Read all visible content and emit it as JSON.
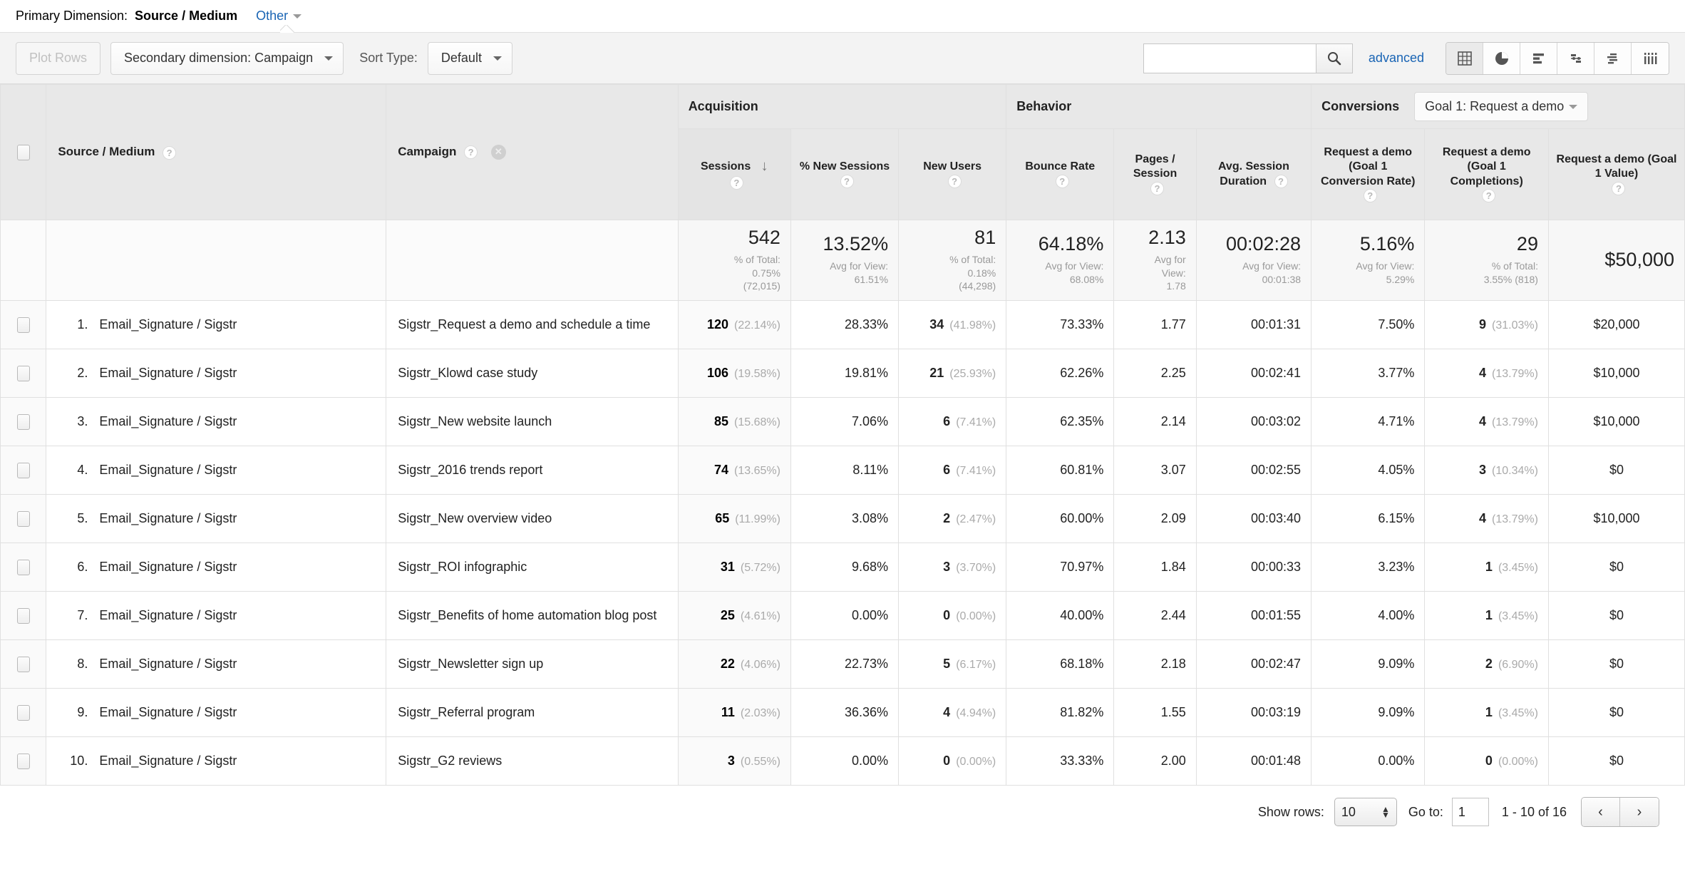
{
  "primary_dimension": {
    "label": "Primary Dimension:",
    "value": "Source / Medium",
    "other": "Other"
  },
  "toolbar": {
    "plot_rows": "Plot Rows",
    "secondary_dimension": "Secondary dimension: Campaign",
    "sort_type_label": "Sort Type:",
    "sort_type_value": "Default",
    "search_value": "",
    "search_placeholder": "",
    "advanced": "advanced",
    "view_icons": [
      "table-view-icon",
      "pie-chart-view-icon",
      "performance-view-icon",
      "comparison-view-icon",
      "term-cloud-view-icon",
      "pivot-view-icon"
    ]
  },
  "table": {
    "groups": {
      "acquisition": "Acquisition",
      "behavior": "Behavior",
      "conversions": "Conversions",
      "goal_select": "Goal 1: Request a demo"
    },
    "dimension_headers": [
      "Source / Medium",
      "Campaign"
    ],
    "metric_headers": [
      "Sessions",
      "% New Sessions",
      "New Users",
      "Bounce Rate",
      "Pages / Session",
      "Avg. Session Duration",
      "Request a demo (Goal 1 Conversion Rate)",
      "Request a demo (Goal 1 Completions)",
      "Request a demo (Goal 1 Value)"
    ],
    "summary": [
      {
        "value": "542",
        "sub1": "% of Total:",
        "sub2": "0.75%",
        "sub3": "(72,015)"
      },
      {
        "value": "13.52%",
        "sub1": "Avg for View:",
        "sub2": "61.51%",
        "sub3": ""
      },
      {
        "value": "81",
        "sub1": "% of Total:",
        "sub2": "0.18%",
        "sub3": "(44,298)"
      },
      {
        "value": "64.18%",
        "sub1": "Avg for View:",
        "sub2": "68.08%",
        "sub3": ""
      },
      {
        "value": "2.13",
        "sub1": "Avg for",
        "sub2": "View:",
        "sub3": "1.78"
      },
      {
        "value": "00:02:28",
        "sub1": "Avg for View:",
        "sub2": "00:01:38",
        "sub3": ""
      },
      {
        "value": "5.16%",
        "sub1": "Avg for View:",
        "sub2": "5.29%",
        "sub3": ""
      },
      {
        "value": "29",
        "sub1": "% of Total:",
        "sub2": "3.55% (818)",
        "sub3": ""
      },
      {
        "value": "$50,000",
        "sub1": "",
        "sub2": "",
        "sub3": ""
      }
    ],
    "rows": [
      {
        "n": "1.",
        "source": "Email_Signature / Sigstr",
        "campaign": "Sigstr_Request a demo and schedule a time",
        "sessions": "120",
        "sessions_pct": "(22.14%)",
        "new_sessions": "28.33%",
        "new_users": "34",
        "new_users_pct": "(41.98%)",
        "bounce": "73.33%",
        "pages": "1.77",
        "duration": "00:01:31",
        "conv_rate": "7.50%",
        "completions": "9",
        "completions_pct": "(31.03%)",
        "value": "$20,000"
      },
      {
        "n": "2.",
        "source": "Email_Signature / Sigstr",
        "campaign": "Sigstr_Klowd case study",
        "sessions": "106",
        "sessions_pct": "(19.58%)",
        "new_sessions": "19.81%",
        "new_users": "21",
        "new_users_pct": "(25.93%)",
        "bounce": "62.26%",
        "pages": "2.25",
        "duration": "00:02:41",
        "conv_rate": "3.77%",
        "completions": "4",
        "completions_pct": "(13.79%)",
        "value": "$10,000"
      },
      {
        "n": "3.",
        "source": "Email_Signature / Sigstr",
        "campaign": "Sigstr_New website launch",
        "sessions": "85",
        "sessions_pct": "(15.68%)",
        "new_sessions": "7.06%",
        "new_users": "6",
        "new_users_pct": "(7.41%)",
        "bounce": "62.35%",
        "pages": "2.14",
        "duration": "00:03:02",
        "conv_rate": "4.71%",
        "completions": "4",
        "completions_pct": "(13.79%)",
        "value": "$10,000"
      },
      {
        "n": "4.",
        "source": "Email_Signature / Sigstr",
        "campaign": "Sigstr_2016 trends report",
        "sessions": "74",
        "sessions_pct": "(13.65%)",
        "new_sessions": "8.11%",
        "new_users": "6",
        "new_users_pct": "(7.41%)",
        "bounce": "60.81%",
        "pages": "3.07",
        "duration": "00:02:55",
        "conv_rate": "4.05%",
        "completions": "3",
        "completions_pct": "(10.34%)",
        "value": "$0"
      },
      {
        "n": "5.",
        "source": "Email_Signature / Sigstr",
        "campaign": "Sigstr_New overview video",
        "sessions": "65",
        "sessions_pct": "(11.99%)",
        "new_sessions": "3.08%",
        "new_users": "2",
        "new_users_pct": "(2.47%)",
        "bounce": "60.00%",
        "pages": "2.09",
        "duration": "00:03:40",
        "conv_rate": "6.15%",
        "completions": "4",
        "completions_pct": "(13.79%)",
        "value": "$10,000"
      },
      {
        "n": "6.",
        "source": "Email_Signature / Sigstr",
        "campaign": "Sigstr_ROI infographic",
        "sessions": "31",
        "sessions_pct": "(5.72%)",
        "new_sessions": "9.68%",
        "new_users": "3",
        "new_users_pct": "(3.70%)",
        "bounce": "70.97%",
        "pages": "1.84",
        "duration": "00:00:33",
        "conv_rate": "3.23%",
        "completions": "1",
        "completions_pct": "(3.45%)",
        "value": "$0"
      },
      {
        "n": "7.",
        "source": "Email_Signature / Sigstr",
        "campaign": "Sigstr_Benefits of home automation blog post",
        "sessions": "25",
        "sessions_pct": "(4.61%)",
        "new_sessions": "0.00%",
        "new_users": "0",
        "new_users_pct": "(0.00%)",
        "bounce": "40.00%",
        "pages": "2.44",
        "duration": "00:01:55",
        "conv_rate": "4.00%",
        "completions": "1",
        "completions_pct": "(3.45%)",
        "value": "$0"
      },
      {
        "n": "8.",
        "source": "Email_Signature / Sigstr",
        "campaign": "Sigstr_Newsletter sign up",
        "sessions": "22",
        "sessions_pct": "(4.06%)",
        "new_sessions": "22.73%",
        "new_users": "5",
        "new_users_pct": "(6.17%)",
        "bounce": "68.18%",
        "pages": "2.18",
        "duration": "00:02:47",
        "conv_rate": "9.09%",
        "completions": "2",
        "completions_pct": "(6.90%)",
        "value": "$0"
      },
      {
        "n": "9.",
        "source": "Email_Signature / Sigstr",
        "campaign": "Sigstr_Referral program",
        "sessions": "11",
        "sessions_pct": "(2.03%)",
        "new_sessions": "36.36%",
        "new_users": "4",
        "new_users_pct": "(4.94%)",
        "bounce": "81.82%",
        "pages": "1.55",
        "duration": "00:03:19",
        "conv_rate": "9.09%",
        "completions": "1",
        "completions_pct": "(3.45%)",
        "value": "$0"
      },
      {
        "n": "10.",
        "source": "Email_Signature / Sigstr",
        "campaign": "Sigstr_G2 reviews",
        "sessions": "3",
        "sessions_pct": "(0.55%)",
        "new_sessions": "0.00%",
        "new_users": "0",
        "new_users_pct": "(0.00%)",
        "bounce": "33.33%",
        "pages": "2.00",
        "duration": "00:01:48",
        "conv_rate": "0.00%",
        "completions": "0",
        "completions_pct": "(0.00%)",
        "value": "$0"
      }
    ]
  },
  "footer": {
    "show_rows_label": "Show rows:",
    "rows_value": "10",
    "goto_label": "Go to:",
    "goto_value": "1",
    "range": "1 - 10 of 16",
    "prev": "‹",
    "next": "›"
  },
  "colors": {
    "link": "#1964b4",
    "header_bg": "#e8e8e8",
    "toolbar_bg": "#f3f3f3",
    "muted": "#aaaaaa"
  }
}
